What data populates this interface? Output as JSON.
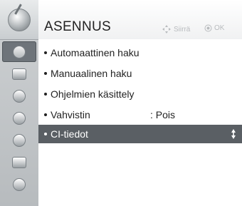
{
  "menu": {
    "title": "ASENNUS",
    "hint_move": "Siirrä",
    "hint_ok": "OK",
    "items": [
      {
        "label": "Automaattinen haku",
        "value": ""
      },
      {
        "label": "Manuaalinen haku",
        "value": ""
      },
      {
        "label": "Ohjelmien käsittely",
        "value": ""
      },
      {
        "label": "Vahvistin",
        "value": ": Pois"
      },
      {
        "label": "CI-tiedot",
        "value": ""
      }
    ],
    "selected_index": 4
  },
  "sidebar": {
    "icons": [
      "satellite-dish-icon",
      "picture-icon",
      "audio-icon",
      "clock-icon",
      "lock-icon",
      "option-icon",
      "network-icon"
    ],
    "active_index": 0
  },
  "colors": {
    "selected_row": "#5a5f64",
    "sidebar": "#b7bbbe",
    "hint": "#b8bbbe"
  }
}
